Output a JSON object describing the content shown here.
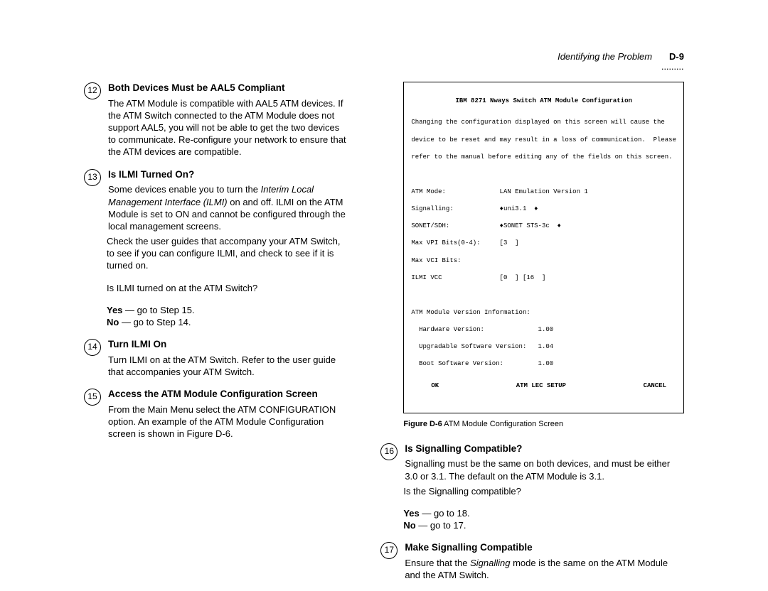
{
  "header": {
    "title": "Identifying the Problem",
    "page": "D-9",
    "dots": "........."
  },
  "steps": {
    "s12": {
      "num": "12",
      "title": "Both Devices Must be AAL5 Compliant",
      "text": "The ATM Module is compatible with AAL5 ATM devices. If the ATM Switch connected to the ATM Module does not support AAL5, you will not be able to get the two devices to communicate. Re-configure your network to ensure that the ATM devices are compatible."
    },
    "s13": {
      "num": "13",
      "title": "Is ILMI Turned On?",
      "p1a": "Some devices enable you to turn the ",
      "p1b": "Interim Local Management Interface (ILMI)",
      "p1c": " on and off. ILMI on the ATM Module is set to ON and cannot be configured through the local management screens.",
      "p2": "Check the user guides that accompany your ATM Switch, to see if you can configure ILMI, and check to see if it is turned on.",
      "p3": "Is ILMI turned on at the ATM Switch?",
      "yes_label": "Yes",
      "yes_text": " — go to Step 15.",
      "no_label": "No",
      "no_text": " — go to Step 14."
    },
    "s14": {
      "num": "14",
      "title": "Turn ILMI On",
      "text": "Turn ILMI on at the ATM Switch. Refer to the user guide that accompanies your ATM Switch."
    },
    "s15": {
      "num": "15",
      "title": "Access the ATM Module Configuration Screen",
      "text": "From the Main Menu select the ATM CONFIGURATION option. An example of the ATM Module Configuration screen is shown in Figure D-6."
    },
    "s16": {
      "num": "16",
      "title": "Is Signalling Compatible?",
      "p1": "Signalling must be the same on both devices, and must be either 3.0 or 3.1. The default on the ATM Module is 3.1.",
      "p2": "Is the Signalling compatible?",
      "yes_label": "Yes",
      "yes_text": " — go to 18.",
      "no_label": "No",
      "no_text": " — go to 17."
    },
    "s17": {
      "num": "17",
      "title": "Make Signalling Compatible",
      "t1": "Ensure that the ",
      "t2": "Signalling",
      "t3": " mode is the same on the ATM Module and the ATM Switch."
    }
  },
  "figure": {
    "title": "IBM 8271 Nways Switch ATM Module Configuration",
    "warn1": "Changing the configuration displayed on this screen will cause the",
    "warn2": "device to be reset and may result in a loss of communication.  Please",
    "warn3": "refer to the manual before editing any of the fields on this screen.",
    "l1": "ATM Mode:              LAN Emulation Version 1",
    "l2": "Signalling:            ♦uni3.1  ♦",
    "l3": "SONET/SDH:             ♦SONET STS-3c  ♦",
    "l4": "Max VPI Bits(0-4):     [3  ]",
    "l5": "Max VCI Bits:",
    "l6": "ILMI VCC               [0  ] [16  ]",
    "vh": "ATM Module Version Information:",
    "v1": "  Hardware Version:              1.00",
    "v2": "  Upgradable Software Version:   1.04",
    "v3": "  Boot Software Version:         1.00",
    "ok": "OK",
    "setup": "ATM LEC SETUP",
    "cancel": "CANCEL",
    "caption_label": "Figure D-6",
    "caption_text": "   ATM Module Configuration Screen"
  }
}
